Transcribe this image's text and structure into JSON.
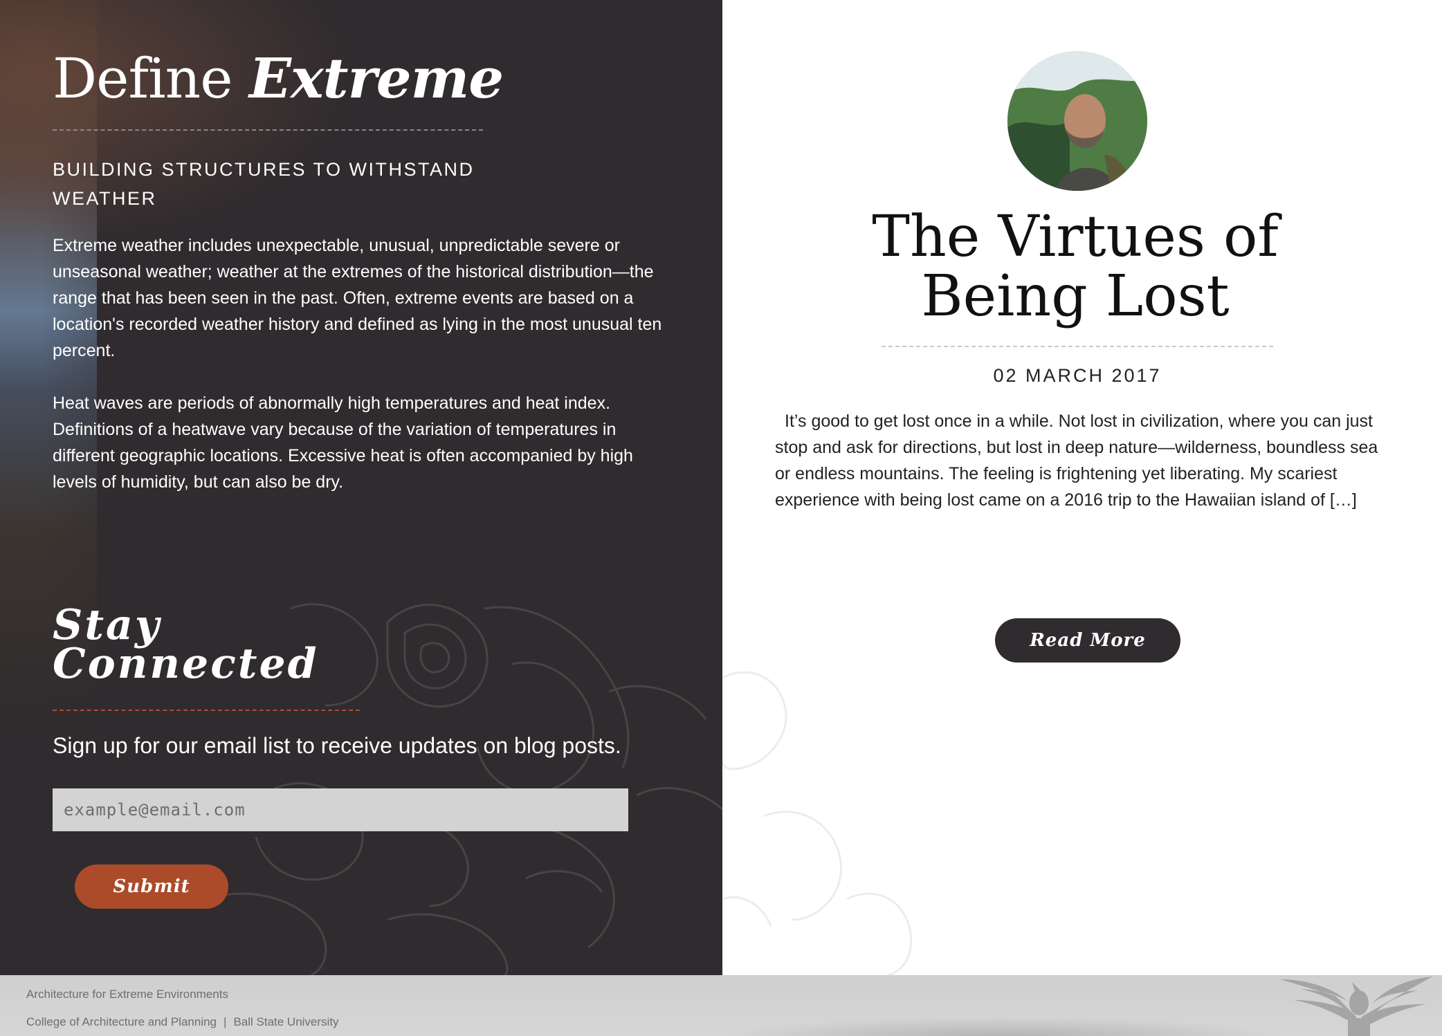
{
  "left_panel": {
    "title_regular": "Define ",
    "title_emphasis": "Extreme",
    "subtitle": "BUILDING STRUCTURES TO WITHSTAND WEATHER",
    "paragraphs": [
      "Extreme weather includes unexpectable, unusual, unpredictable severe or unseasonal weather; weather at the extremes of the historical distribution—the range that has been seen in the past. Often, extreme events are based on a location's recorded weather history and defined as lying in the most unusual ten percent.",
      "Heat waves are periods of abnormally high temperatures and heat index. Definitions of a heatwave vary because of the variation of temperatures in different geographic locations. Excessive heat is often accompanied by high levels of humidity, but can also be dry."
    ],
    "stay_connected": {
      "title_line_1": "Stay",
      "title_line_2": "Connected",
      "description": "Sign up for our email list to receive updates on blog posts.",
      "email_placeholder": "example@email.com",
      "email_value": "",
      "submit_label": "Submit"
    }
  },
  "right_panel": {
    "post": {
      "title": "The Virtues of Being Lost",
      "date": "02 MARCH 2017",
      "excerpt": "It’s good to get lost once in a while. Not lost in civilization, where you can just stop and ask for directions, but lost in deep nature—wilderness, boundless sea or endless mountains. The feeling is frightening yet liberating. My scariest experience with being lost came on a 2016 trip to the Hawaiian island of […]",
      "read_more_label": "Read More"
    }
  },
  "footer": {
    "site_name": "Architecture for Extreme Environments",
    "college": "College of Architecture and Planning",
    "separator": "|",
    "university": "Ball State University"
  },
  "icons": {
    "footer_logo": "cardinal-logo-icon",
    "avatar": "author-avatar"
  },
  "colors": {
    "dark_panel": "#2f2b2e",
    "accent_orange": "#ab4b2a",
    "footer_bg": "#d3d3d3"
  }
}
